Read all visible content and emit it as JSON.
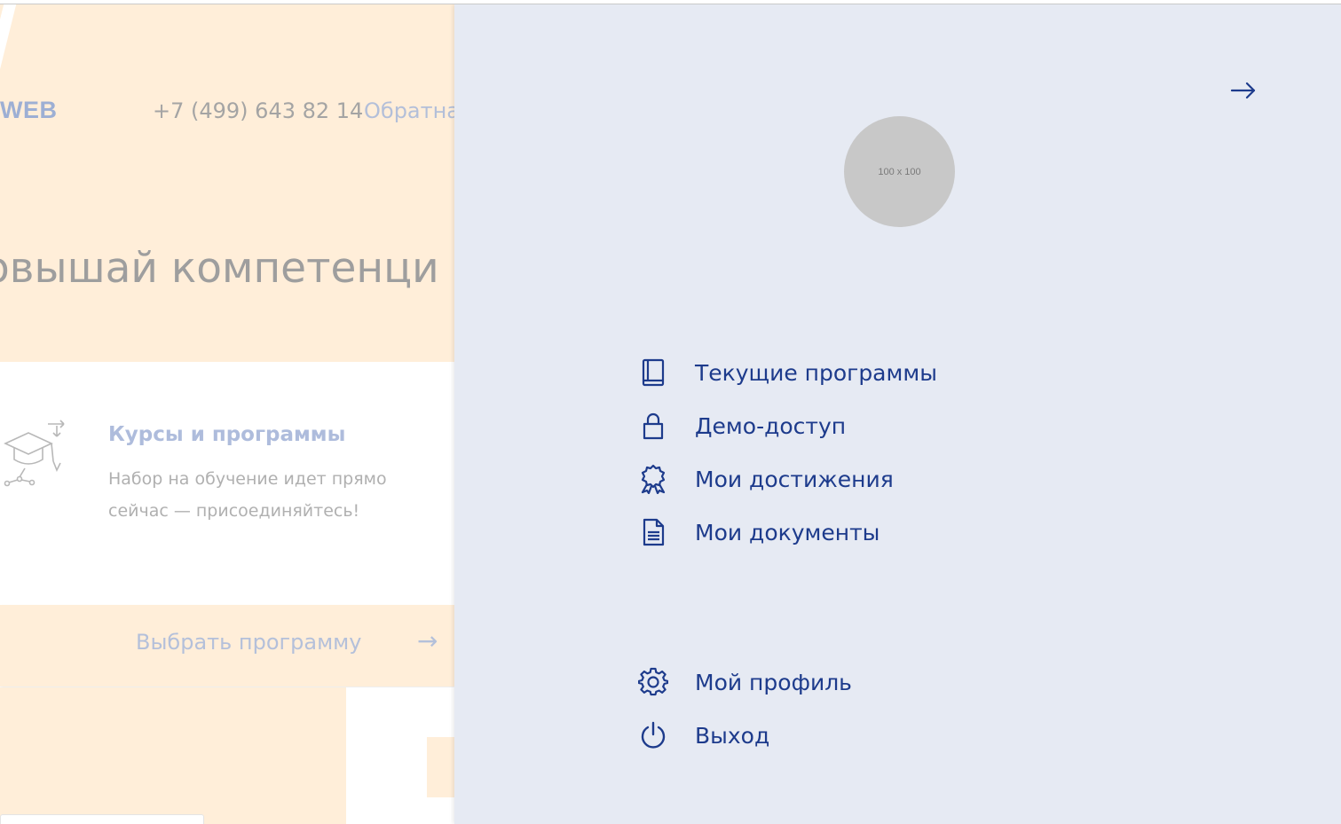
{
  "background": {
    "logo": "WEB",
    "phone": "+7 (499) 643 82 14",
    "callback_link": "Обратна",
    "hero_title": "овышай компетенци",
    "card": {
      "title": "Курсы и программы",
      "text": "Набор на обучение идет прямо сейчас — присоединяйтесь!"
    },
    "cta": {
      "label": "Выбрать программу",
      "arrow": "→"
    }
  },
  "panel": {
    "close_icon": "arrow-right-icon",
    "avatar_placeholder": "100 x 100",
    "menu": [
      {
        "label": "Текущие программы",
        "icon": "book-icon"
      },
      {
        "label": "Демо-доступ",
        "icon": "lock-icon"
      },
      {
        "label": "Мои достижения",
        "icon": "award-icon"
      },
      {
        "label": "Мои документы",
        "icon": "document-icon"
      }
    ],
    "bottom_menu": [
      {
        "label": "Мой профиль",
        "icon": "gear-icon"
      },
      {
        "label": "Выход",
        "icon": "power-icon"
      }
    ]
  },
  "colors": {
    "panel_bg": "#e6eaf3",
    "accent": "#1d3b8c",
    "peach": "#ffeed9"
  }
}
